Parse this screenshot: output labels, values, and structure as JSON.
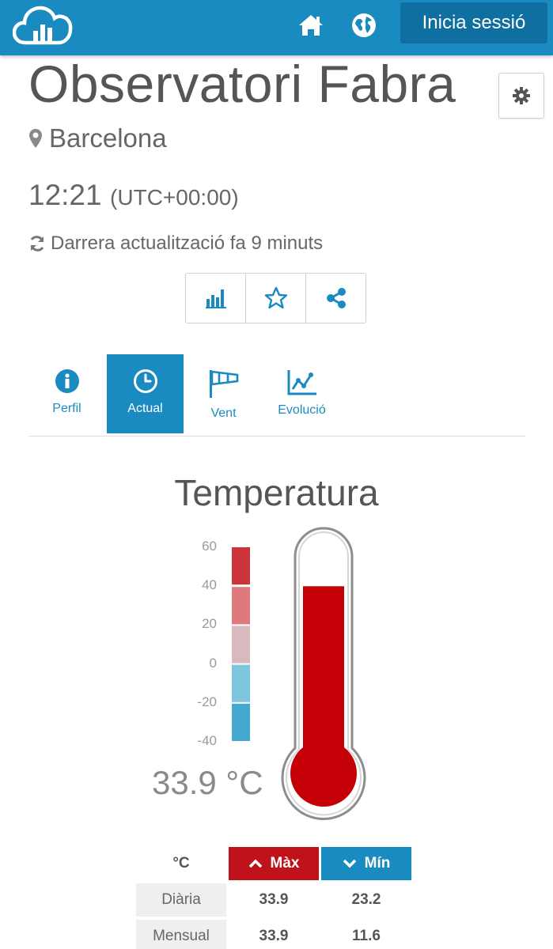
{
  "header": {
    "login_label": "Inicia sessió"
  },
  "station": {
    "title": "Observatori Fabra",
    "location": "Barcelona",
    "time": "12:21",
    "timezone": "(UTC+00:00)",
    "last_update": "Darrera actualització fa 9 minuts"
  },
  "tabs": [
    {
      "label": "Perfil",
      "icon": "info-icon",
      "active": false
    },
    {
      "label": "Actual",
      "icon": "clock-icon",
      "active": true
    },
    {
      "label": "Vent",
      "icon": "windsock-icon",
      "active": false
    },
    {
      "label": "Evolució",
      "icon": "line-chart-icon",
      "active": false
    }
  ],
  "temperature": {
    "title": "Temperatura",
    "value": 33.9,
    "display": "33.9 °C",
    "scale_min": -40,
    "scale_max": 60,
    "scale_labels": [
      "60",
      "40",
      "20",
      "0",
      "-20",
      "-40"
    ],
    "band_colors": [
      "#c9353b",
      "#de7a7d",
      "#d8b9bd",
      "#7ec5de",
      "#45a9cf"
    ],
    "fill_color": "#c40006"
  },
  "stats": {
    "unit": "°C",
    "max_label": "Màx",
    "min_label": "Mín",
    "rows": [
      {
        "label": "Diària",
        "max": "33.9",
        "min": "23.2"
      },
      {
        "label": "Mensual",
        "max": "33.9",
        "min": "11.6"
      }
    ]
  },
  "colors": {
    "brand": "#1a8bc0",
    "max": "#c0121a",
    "min": "#1a8bc0"
  }
}
